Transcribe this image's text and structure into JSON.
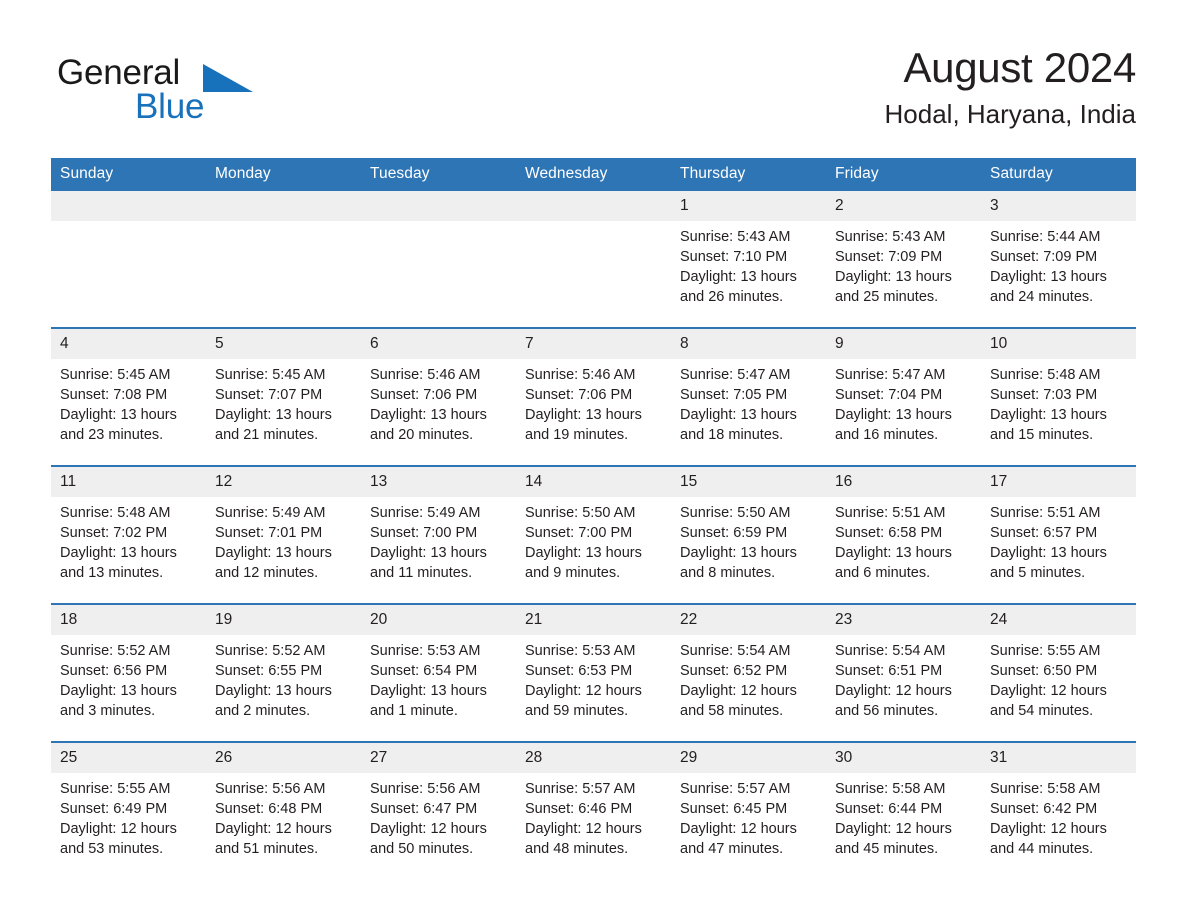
{
  "brand": {
    "line1": "General",
    "line2": "Blue",
    "triangle_color": "#1871bb"
  },
  "header": {
    "title": "August 2024",
    "subtitle": "Hodal, Haryana, India"
  },
  "theme": {
    "header_blue": "#2e75b6",
    "daynum_gray": "#efefef",
    "text": "#231f20"
  },
  "weekday_headers": [
    "Sunday",
    "Monday",
    "Tuesday",
    "Wednesday",
    "Thursday",
    "Friday",
    "Saturday"
  ],
  "weeks": [
    [
      {
        "day": "",
        "sunrise": "",
        "sunset": "",
        "daylight1": "",
        "daylight2": ""
      },
      {
        "day": "",
        "sunrise": "",
        "sunset": "",
        "daylight1": "",
        "daylight2": ""
      },
      {
        "day": "",
        "sunrise": "",
        "sunset": "",
        "daylight1": "",
        "daylight2": ""
      },
      {
        "day": "",
        "sunrise": "",
        "sunset": "",
        "daylight1": "",
        "daylight2": ""
      },
      {
        "day": "1",
        "sunrise": "Sunrise: 5:43 AM",
        "sunset": "Sunset: 7:10 PM",
        "daylight1": "Daylight: 13 hours",
        "daylight2": "and 26 minutes."
      },
      {
        "day": "2",
        "sunrise": "Sunrise: 5:43 AM",
        "sunset": "Sunset: 7:09 PM",
        "daylight1": "Daylight: 13 hours",
        "daylight2": "and 25 minutes."
      },
      {
        "day": "3",
        "sunrise": "Sunrise: 5:44 AM",
        "sunset": "Sunset: 7:09 PM",
        "daylight1": "Daylight: 13 hours",
        "daylight2": "and 24 minutes."
      }
    ],
    [
      {
        "day": "4",
        "sunrise": "Sunrise: 5:45 AM",
        "sunset": "Sunset: 7:08 PM",
        "daylight1": "Daylight: 13 hours",
        "daylight2": "and 23 minutes."
      },
      {
        "day": "5",
        "sunrise": "Sunrise: 5:45 AM",
        "sunset": "Sunset: 7:07 PM",
        "daylight1": "Daylight: 13 hours",
        "daylight2": "and 21 minutes."
      },
      {
        "day": "6",
        "sunrise": "Sunrise: 5:46 AM",
        "sunset": "Sunset: 7:06 PM",
        "daylight1": "Daylight: 13 hours",
        "daylight2": "and 20 minutes."
      },
      {
        "day": "7",
        "sunrise": "Sunrise: 5:46 AM",
        "sunset": "Sunset: 7:06 PM",
        "daylight1": "Daylight: 13 hours",
        "daylight2": "and 19 minutes."
      },
      {
        "day": "8",
        "sunrise": "Sunrise: 5:47 AM",
        "sunset": "Sunset: 7:05 PM",
        "daylight1": "Daylight: 13 hours",
        "daylight2": "and 18 minutes."
      },
      {
        "day": "9",
        "sunrise": "Sunrise: 5:47 AM",
        "sunset": "Sunset: 7:04 PM",
        "daylight1": "Daylight: 13 hours",
        "daylight2": "and 16 minutes."
      },
      {
        "day": "10",
        "sunrise": "Sunrise: 5:48 AM",
        "sunset": "Sunset: 7:03 PM",
        "daylight1": "Daylight: 13 hours",
        "daylight2": "and 15 minutes."
      }
    ],
    [
      {
        "day": "11",
        "sunrise": "Sunrise: 5:48 AM",
        "sunset": "Sunset: 7:02 PM",
        "daylight1": "Daylight: 13 hours",
        "daylight2": "and 13 minutes."
      },
      {
        "day": "12",
        "sunrise": "Sunrise: 5:49 AM",
        "sunset": "Sunset: 7:01 PM",
        "daylight1": "Daylight: 13 hours",
        "daylight2": "and 12 minutes."
      },
      {
        "day": "13",
        "sunrise": "Sunrise: 5:49 AM",
        "sunset": "Sunset: 7:00 PM",
        "daylight1": "Daylight: 13 hours",
        "daylight2": "and 11 minutes."
      },
      {
        "day": "14",
        "sunrise": "Sunrise: 5:50 AM",
        "sunset": "Sunset: 7:00 PM",
        "daylight1": "Daylight: 13 hours",
        "daylight2": "and 9 minutes."
      },
      {
        "day": "15",
        "sunrise": "Sunrise: 5:50 AM",
        "sunset": "Sunset: 6:59 PM",
        "daylight1": "Daylight: 13 hours",
        "daylight2": "and 8 minutes."
      },
      {
        "day": "16",
        "sunrise": "Sunrise: 5:51 AM",
        "sunset": "Sunset: 6:58 PM",
        "daylight1": "Daylight: 13 hours",
        "daylight2": "and 6 minutes."
      },
      {
        "day": "17",
        "sunrise": "Sunrise: 5:51 AM",
        "sunset": "Sunset: 6:57 PM",
        "daylight1": "Daylight: 13 hours",
        "daylight2": "and 5 minutes."
      }
    ],
    [
      {
        "day": "18",
        "sunrise": "Sunrise: 5:52 AM",
        "sunset": "Sunset: 6:56 PM",
        "daylight1": "Daylight: 13 hours",
        "daylight2": "and 3 minutes."
      },
      {
        "day": "19",
        "sunrise": "Sunrise: 5:52 AM",
        "sunset": "Sunset: 6:55 PM",
        "daylight1": "Daylight: 13 hours",
        "daylight2": "and 2 minutes."
      },
      {
        "day": "20",
        "sunrise": "Sunrise: 5:53 AM",
        "sunset": "Sunset: 6:54 PM",
        "daylight1": "Daylight: 13 hours",
        "daylight2": "and 1 minute."
      },
      {
        "day": "21",
        "sunrise": "Sunrise: 5:53 AM",
        "sunset": "Sunset: 6:53 PM",
        "daylight1": "Daylight: 12 hours",
        "daylight2": "and 59 minutes."
      },
      {
        "day": "22",
        "sunrise": "Sunrise: 5:54 AM",
        "sunset": "Sunset: 6:52 PM",
        "daylight1": "Daylight: 12 hours",
        "daylight2": "and 58 minutes."
      },
      {
        "day": "23",
        "sunrise": "Sunrise: 5:54 AM",
        "sunset": "Sunset: 6:51 PM",
        "daylight1": "Daylight: 12 hours",
        "daylight2": "and 56 minutes."
      },
      {
        "day": "24",
        "sunrise": "Sunrise: 5:55 AM",
        "sunset": "Sunset: 6:50 PM",
        "daylight1": "Daylight: 12 hours",
        "daylight2": "and 54 minutes."
      }
    ],
    [
      {
        "day": "25",
        "sunrise": "Sunrise: 5:55 AM",
        "sunset": "Sunset: 6:49 PM",
        "daylight1": "Daylight: 12 hours",
        "daylight2": "and 53 minutes."
      },
      {
        "day": "26",
        "sunrise": "Sunrise: 5:56 AM",
        "sunset": "Sunset: 6:48 PM",
        "daylight1": "Daylight: 12 hours",
        "daylight2": "and 51 minutes."
      },
      {
        "day": "27",
        "sunrise": "Sunrise: 5:56 AM",
        "sunset": "Sunset: 6:47 PM",
        "daylight1": "Daylight: 12 hours",
        "daylight2": "and 50 minutes."
      },
      {
        "day": "28",
        "sunrise": "Sunrise: 5:57 AM",
        "sunset": "Sunset: 6:46 PM",
        "daylight1": "Daylight: 12 hours",
        "daylight2": "and 48 minutes."
      },
      {
        "day": "29",
        "sunrise": "Sunrise: 5:57 AM",
        "sunset": "Sunset: 6:45 PM",
        "daylight1": "Daylight: 12 hours",
        "daylight2": "and 47 minutes."
      },
      {
        "day": "30",
        "sunrise": "Sunrise: 5:58 AM",
        "sunset": "Sunset: 6:44 PM",
        "daylight1": "Daylight: 12 hours",
        "daylight2": "and 45 minutes."
      },
      {
        "day": "31",
        "sunrise": "Sunrise: 5:58 AM",
        "sunset": "Sunset: 6:42 PM",
        "daylight1": "Daylight: 12 hours",
        "daylight2": "and 44 minutes."
      }
    ]
  ]
}
